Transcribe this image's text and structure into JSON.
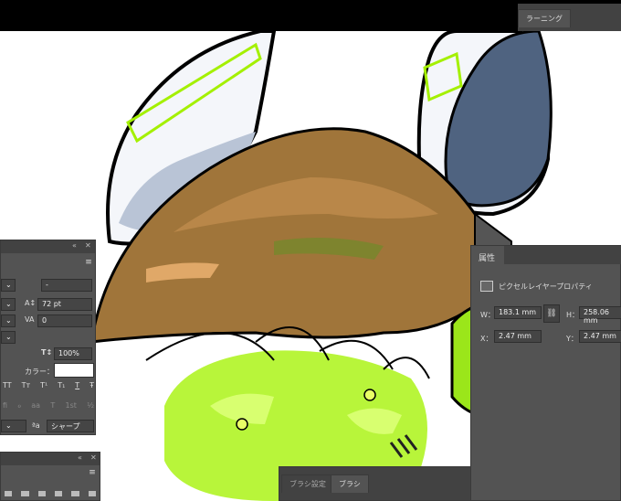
{
  "learning_panel": {
    "tab_label": "ラーニング"
  },
  "character_panel": {
    "collapse_icon": "double-chevron-icon",
    "close_icon": "close-icon",
    "font_style_value": "-",
    "leading_value": "72 pt",
    "tracking_value": "0",
    "vertical_scale_value": "100%",
    "color_label": "カラー：",
    "color_value": "#ffffff",
    "style_buttons": [
      "TT",
      "Tт",
      "T¹",
      "T₁",
      "T",
      "Ŧ"
    ],
    "opentype_buttons": [
      "fi",
      "ℴ",
      "aa",
      "T",
      "1st",
      "½"
    ],
    "antialias_icon": "aa-icon",
    "antialias_value": "シャープ"
  },
  "properties_panel": {
    "tab_label": "属性",
    "layer_type_label": "ピクセルレイヤープロパティ",
    "w_label": "W：",
    "w_value": "183.1 mm",
    "h_label": "H：",
    "h_value": "258.06 mm",
    "x_label": "X：",
    "x_value": "2.47 mm",
    "y_label": "Y：",
    "y_value": "2.47 mm",
    "link_icon": "link-icon"
  },
  "brush_panel": {
    "tabs": [
      "ブラシ設定",
      "ブラシ"
    ]
  },
  "bottom_left_panel": {
    "collapse_icon": "double-chevron-icon",
    "close_icon": "close-icon"
  }
}
